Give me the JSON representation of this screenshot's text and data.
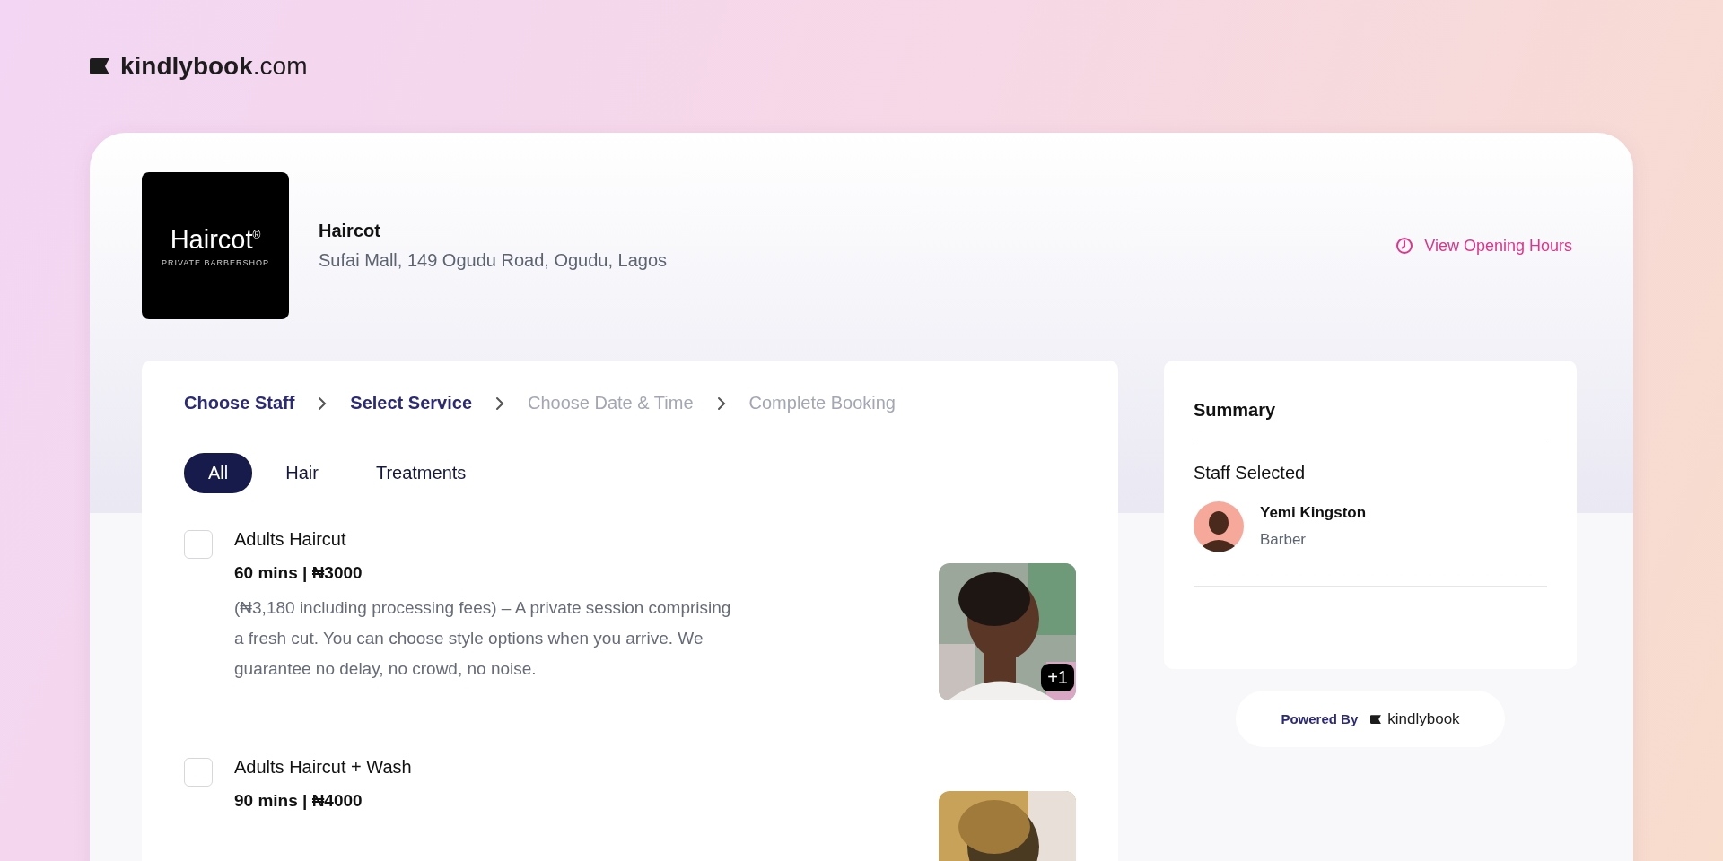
{
  "brand": {
    "logo_text": "**kindlybook**.com"
  },
  "business": {
    "logo_name": "Haircot",
    "logo_mark": "®",
    "logo_tagline": "PRIVATE BARBERSHOP",
    "name": "Haircot",
    "address": "Sufai Mall, 149 Ogudu Road, Ogudu, Lagos",
    "hours_link": "View Opening Hours"
  },
  "steps": [
    {
      "label": "Choose Staff",
      "active": true
    },
    {
      "label": "Select Service",
      "active": true
    },
    {
      "label": "Choose Date & Time",
      "active": false
    },
    {
      "label": "Complete Booking",
      "active": false
    }
  ],
  "categories": [
    {
      "label": "All",
      "selected": true
    },
    {
      "label": "Hair",
      "selected": false
    },
    {
      "label": "Treatments",
      "selected": false
    }
  ],
  "services": [
    {
      "title": "Adults Haircut",
      "duration_price": "60 mins | ₦3000",
      "description": "(₦3,180 including processing fees) – A private session comprising a fresh cut. You can choose style options when you arrive. We guarantee no delay, no crowd, no noise.",
      "checked": false,
      "photo_count": "+1"
    },
    {
      "title": "Adults Haircut + Wash",
      "duration_price": "90 mins | ₦4000",
      "checked": false
    }
  ],
  "summary": {
    "title": "Summary",
    "staff_heading": "Staff Selected",
    "staff": {
      "name": "Yemi Kingston",
      "role": "Barber"
    }
  },
  "powered": {
    "label": "Powered By",
    "brand": "kindlybook"
  }
}
